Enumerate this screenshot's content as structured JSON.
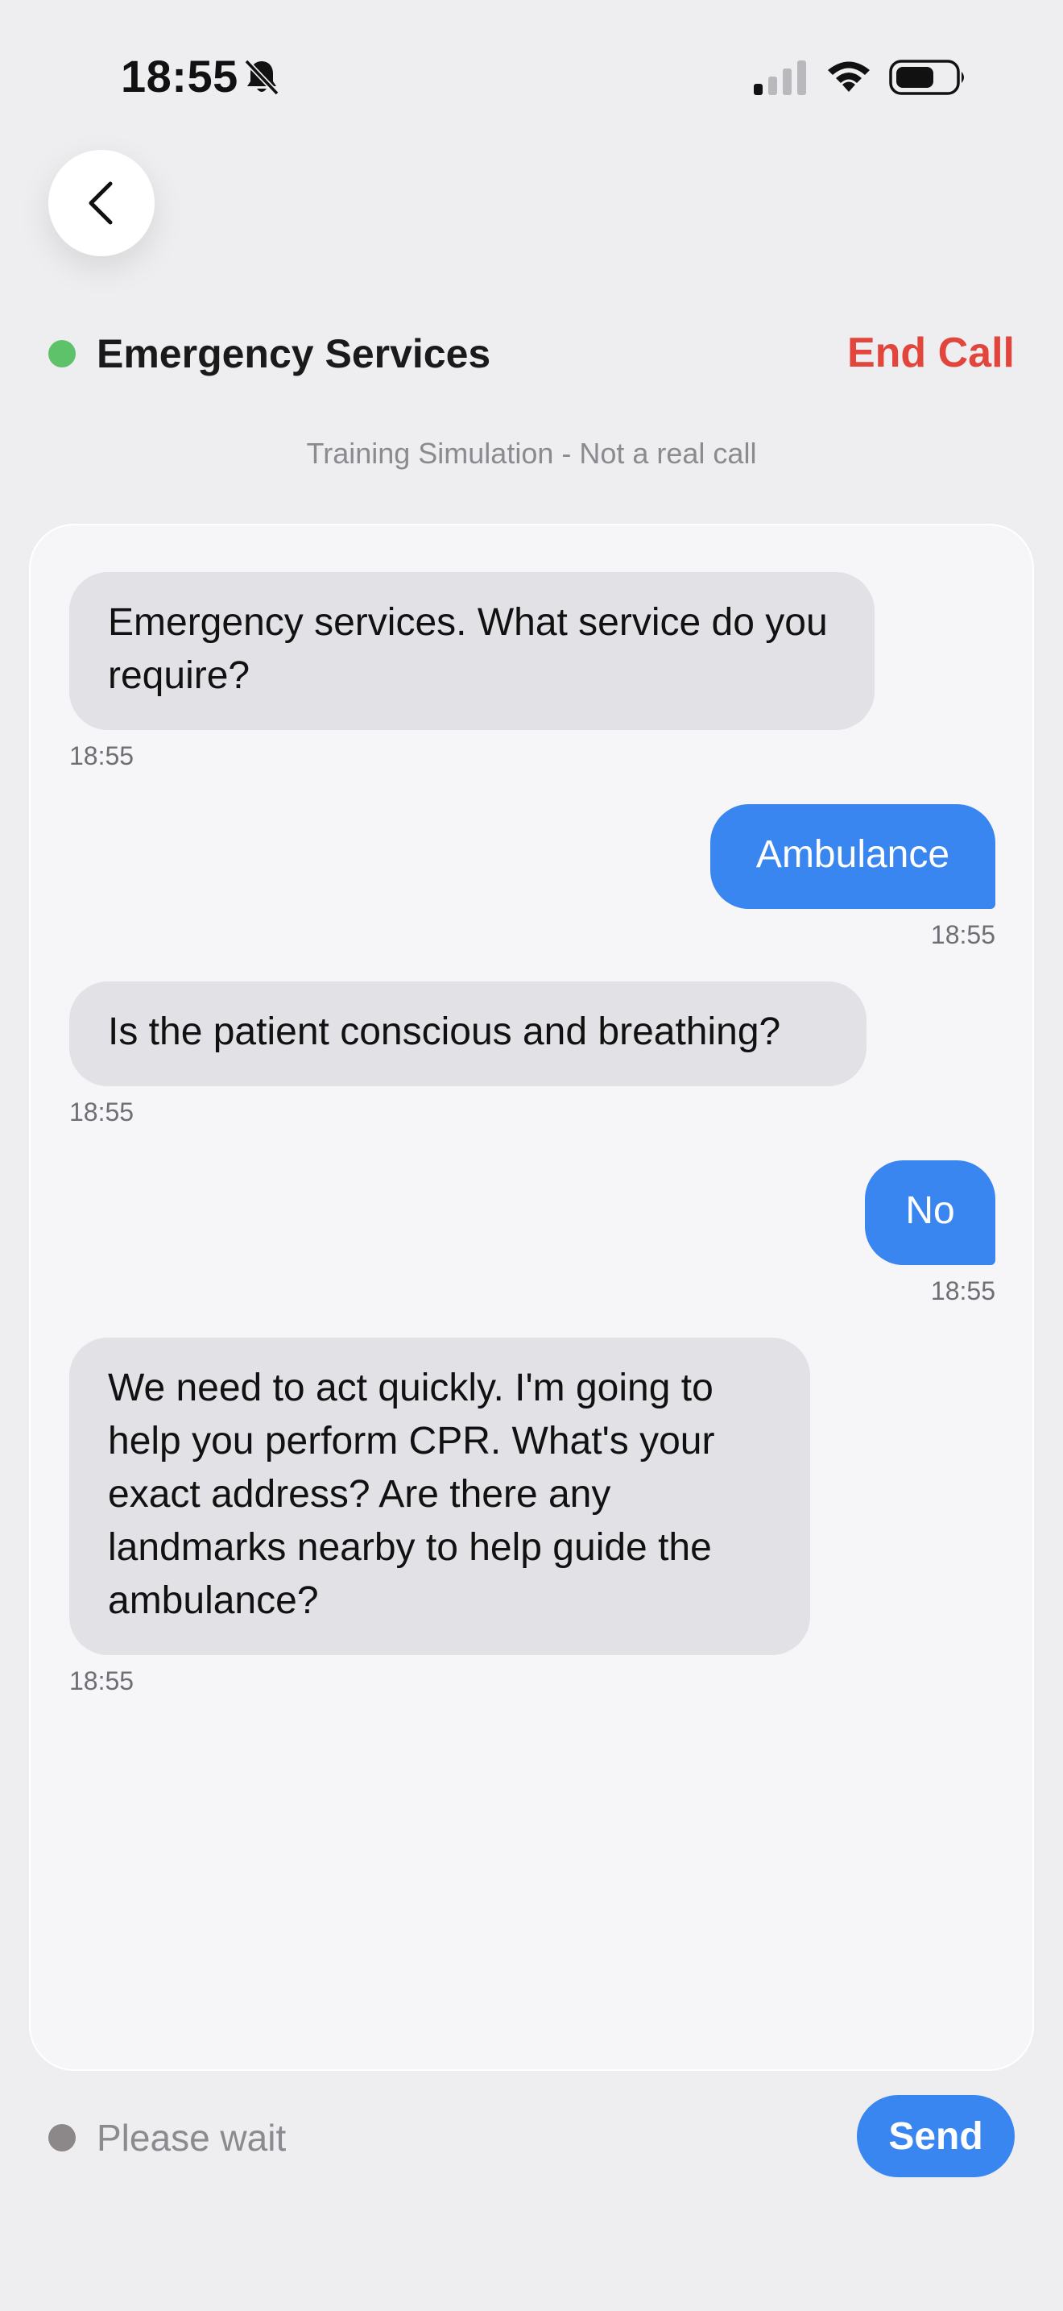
{
  "status_bar": {
    "time": "18:55",
    "icons": [
      "bell-slash-icon",
      "cellular-signal-icon",
      "wifi-icon",
      "battery-icon"
    ]
  },
  "nav": {
    "back_icon": "chevron-left-icon"
  },
  "header": {
    "title": "Emergency Services",
    "end_call_label": "End Call",
    "subtitle": "Training Simulation - Not a real call",
    "status_color": "#5ec26a",
    "end_call_color": "#e2453c"
  },
  "messages": [
    {
      "sender": "operator",
      "text": "Emergency services. What service do you require?",
      "time": "18:55"
    },
    {
      "sender": "user",
      "text": "Ambulance",
      "time": "18:55"
    },
    {
      "sender": "operator",
      "text": "Is the patient conscious and breathing?",
      "time": "18:55"
    },
    {
      "sender": "user",
      "text": "No",
      "time": "18:55"
    },
    {
      "sender": "operator",
      "text": "We need to act quickly. I'm going to help you perform CPR. What's your exact address? Are there any landmarks nearby to help guide the ambulance?",
      "time": "18:55"
    }
  ],
  "composer": {
    "placeholder": "Please wait",
    "send_label": "Send",
    "accent_color": "#3a86f0"
  }
}
